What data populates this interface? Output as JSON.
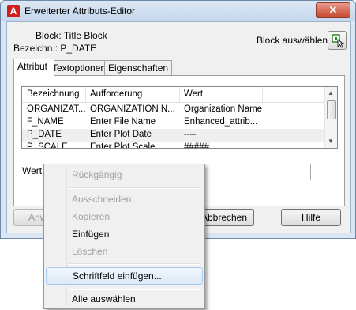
{
  "window": {
    "title": "Erweiterter Attributs-Editor",
    "app_icon": "A",
    "close_glyph": "✕"
  },
  "info": {
    "block": "Block: Title Block",
    "tag": "Bezeichn.: P_DATE",
    "pick_label": "Block auswählen",
    "pick_icon": "select-block-icon"
  },
  "tabs": [
    {
      "label": "Attribut",
      "active": true
    },
    {
      "label": "Textoptionen",
      "active": false
    },
    {
      "label": "Eigenschaften",
      "active": false
    }
  ],
  "grid": {
    "columns": [
      "Bezeichnung",
      "Aufforderung",
      "Wert"
    ],
    "rows": [
      [
        "ORGANIZAT...",
        "ORGANIZATION N...",
        "Organization Name"
      ],
      [
        "F_NAME",
        "Enter File Name",
        "Enhanced_attrib..."
      ],
      [
        "P_DATE",
        "Enter Plot Date",
        "----"
      ],
      [
        "P_SCALE",
        "Enter Plot Scale",
        "#####"
      ]
    ],
    "selected_row": 2
  },
  "value": {
    "label": "Wert:",
    "text": ""
  },
  "buttons": {
    "apply": "Anwe",
    "cancel": "Abbrechen",
    "help": "Hilfe"
  },
  "context_menu": {
    "items": [
      {
        "label": "Rückgängig",
        "enabled": false
      },
      {
        "separator": true
      },
      {
        "label": "Ausschneiden",
        "enabled": false
      },
      {
        "label": "Kopieren",
        "enabled": false
      },
      {
        "label": "Einfügen",
        "enabled": true
      },
      {
        "label": "Löschen",
        "enabled": false
      },
      {
        "separator": true
      },
      {
        "label": "Schriftfeld einfügen...",
        "enabled": true,
        "highlighted": true
      },
      {
        "separator": true
      },
      {
        "label": "Alle auswählen",
        "enabled": true
      }
    ]
  }
}
